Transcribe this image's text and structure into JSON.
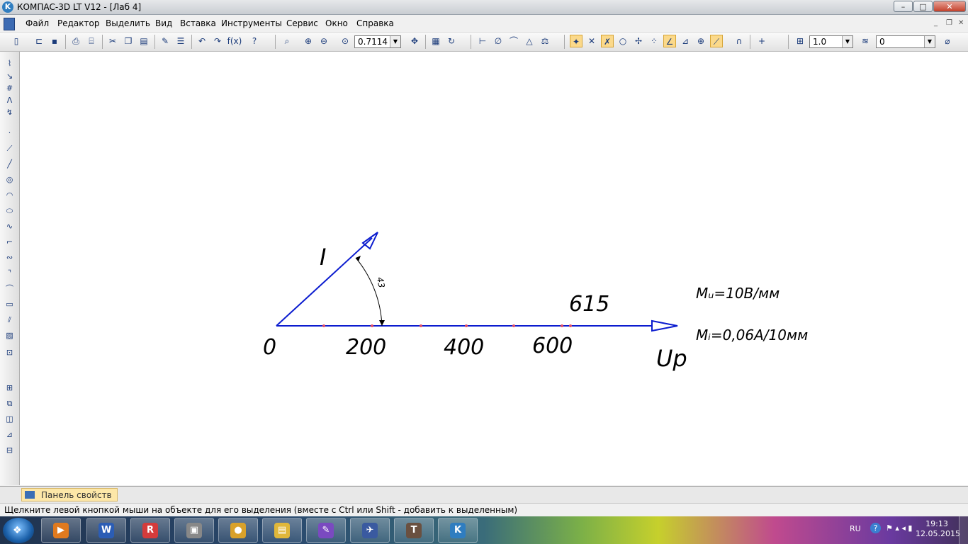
{
  "window": {
    "title": "КОМПАС-3D LT V12 - [Лаб 4]",
    "app_icon": "K",
    "controls": {
      "minimize": "–",
      "maximize": "□",
      "close": "✕"
    }
  },
  "menu": {
    "items": [
      "Файл",
      "Редактор",
      "Выделить",
      "Вид",
      "Вставка",
      "Инструменты",
      "Сервис",
      "Окно",
      "Справка"
    ],
    "mdi": {
      "minimize": "_",
      "restore": "❐",
      "close": "✕"
    }
  },
  "toolbar": {
    "zoom_value": "0.7114",
    "step_value": "1.0",
    "layer_value": "0",
    "formula_label": "f(x)"
  },
  "drawing": {
    "origin_label": "0",
    "tick_labels": [
      "200",
      "400",
      "600"
    ],
    "value_label": "615",
    "current_label": "I",
    "voltage_label": "Up",
    "angle_label": "43",
    "scale_voltage": "Mᵤ=10В/мм",
    "scale_current": "Mᵢ=0,06А/10мм",
    "line_color": "#0b1ccf",
    "point_color": "#e0506a"
  },
  "panel": {
    "tab_label": "Панель свойств"
  },
  "status": {
    "text": "Щелкните левой кнопкой мыши на объекте для его выделения (вместе с Ctrl или Shift - добавить к выделенным)"
  },
  "taskbar": {
    "apps": [
      {
        "icon": "media-player-icon",
        "glyph": "▶",
        "color": "#e07a1f"
      },
      {
        "icon": "word-icon",
        "glyph": "W",
        "color": "#2b5db5"
      },
      {
        "icon": "pdf-reader-icon",
        "glyph": "R",
        "color": "#d43b3b"
      },
      {
        "icon": "archive-icon",
        "glyph": "▣",
        "color": "#888"
      },
      {
        "icon": "chrome-icon",
        "glyph": "●",
        "color": "#d9a12a"
      },
      {
        "icon": "explorer-icon",
        "glyph": "▤",
        "color": "#e0b73a"
      },
      {
        "icon": "notes-icon",
        "glyph": "✎",
        "color": "#7a4ac0"
      },
      {
        "icon": "game-icon",
        "glyph": "✈",
        "color": "#3a5aa0"
      },
      {
        "icon": "world-of-tanks-icon",
        "glyph": "T",
        "color": "#6a5040"
      },
      {
        "icon": "kompas-icon",
        "glyph": "K",
        "color": "#2f7dc0"
      }
    ],
    "tray": {
      "language": "RU",
      "time": "19:13",
      "date": "12.05.2015"
    }
  }
}
